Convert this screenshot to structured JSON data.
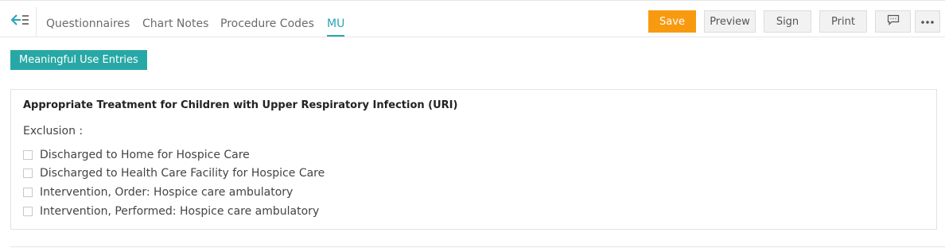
{
  "tabs": [
    {
      "label": "Questionnaires"
    },
    {
      "label": "Chart Notes"
    },
    {
      "label": "Procedure Codes"
    },
    {
      "label": "MU",
      "active": true
    }
  ],
  "toolbar": {
    "save_label": "Save",
    "preview_label": "Preview",
    "sign_label": "Sign",
    "print_label": "Print"
  },
  "icons": {
    "back": "collapse-left-icon",
    "comment": "comment-icon",
    "more": "more-horizontal-icon"
  },
  "section_button": "Meaningful Use Entries",
  "panel": {
    "title": "Appropriate Treatment for Children with Upper Respiratory Infection (URI)",
    "exclusion_label": "Exclusion :",
    "items": [
      {
        "label": "Discharged to Home for Hospice Care",
        "checked": false
      },
      {
        "label": "Discharged to Health Care Facility for Hospice Care",
        "checked": false
      },
      {
        "label": "Intervention, Order: Hospice care ambulatory",
        "checked": false
      },
      {
        "label": "Intervention, Performed: Hospice care ambulatory",
        "checked": false
      }
    ]
  },
  "colors": {
    "accent": "#2aa3b6",
    "save": "#f89a10",
    "section_button": "#27a8a6"
  }
}
